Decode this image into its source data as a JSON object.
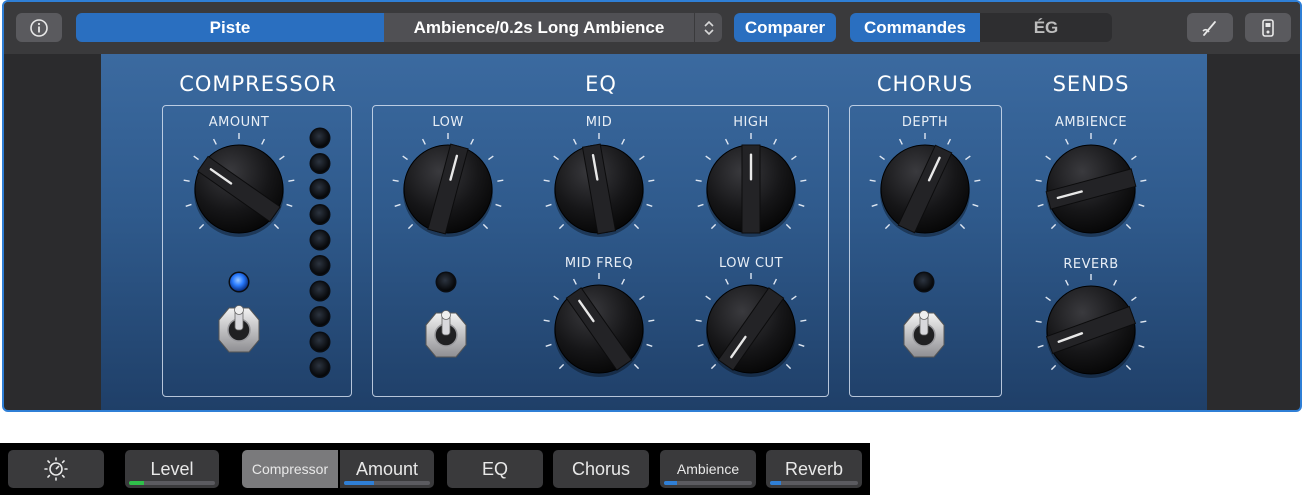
{
  "toolbar": {
    "info_icon": "info-icon",
    "piste_label": "Piste",
    "preset_name": "Ambience/0.2s Long Ambience",
    "compare_label": "Comparer",
    "controls_label": "Commandes",
    "eq_label": "ÉG",
    "tuner_icon": "tuner-icon",
    "pedal_icon": "pedal-icon"
  },
  "sections": {
    "compressor": "COMPRESSOR",
    "eq": "EQ",
    "chorus": "CHORUS",
    "sends": "SENDS"
  },
  "knobs": {
    "amount": "AMOUNT",
    "low": "LOW",
    "mid": "MID",
    "high": "HIGH",
    "mid_freq": "MID FREQ",
    "low_cut": "LOW CUT",
    "depth": "DEPTH",
    "ambience": "AMBIENCE",
    "reverb": "REVERB"
  },
  "touchbar": {
    "settings_icon": "brightness-icon",
    "level_label": "Level",
    "compressor_label": "Compressor",
    "amount_label": "Amount",
    "eq_label": "EQ",
    "chorus_label": "Chorus",
    "ambience_label": "Ambience",
    "reverb_label": "Reverb",
    "level_value": 0.18,
    "amount_value": 0.35,
    "ambience_value": 0.15,
    "reverb_value": 0.12,
    "accent_green": "#2fbf4a",
    "accent_blue": "#2f7fd6"
  }
}
